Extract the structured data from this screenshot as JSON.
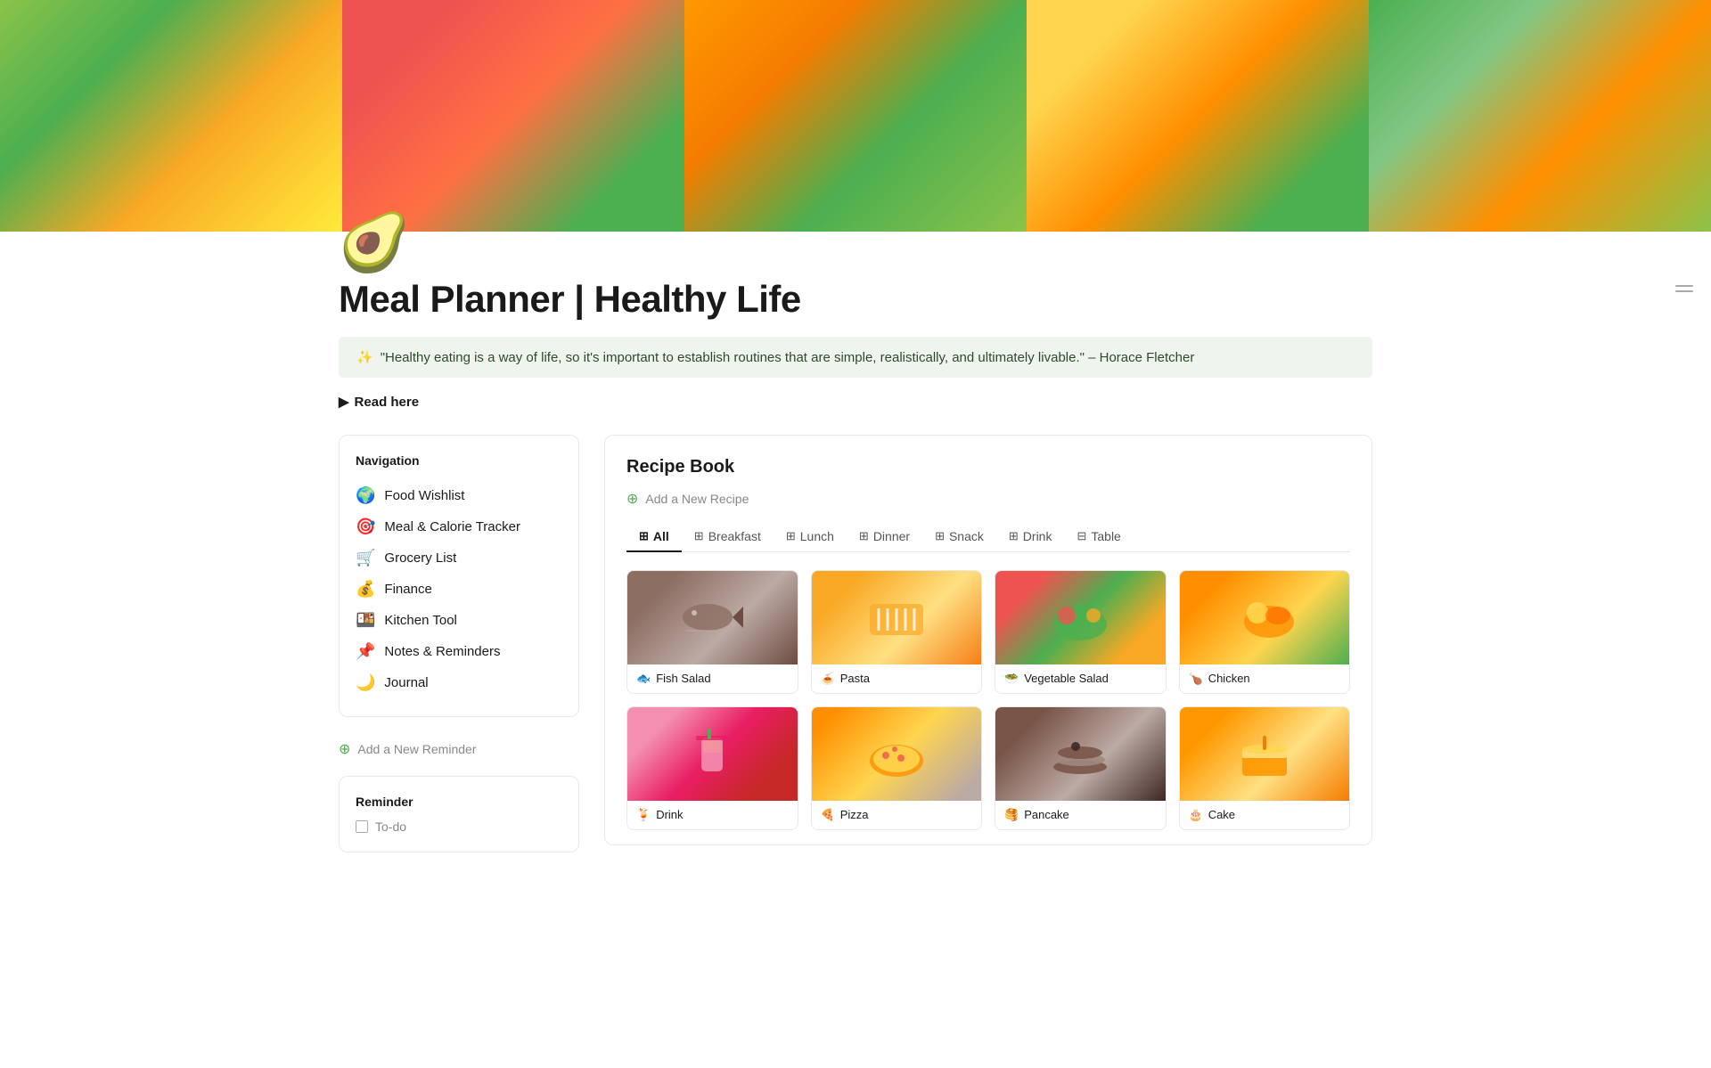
{
  "hero": {
    "images": [
      {
        "id": "hero-1",
        "class": "hero-img-1"
      },
      {
        "id": "hero-2",
        "class": "hero-img-2"
      },
      {
        "id": "hero-3",
        "class": "hero-img-3"
      },
      {
        "id": "hero-4",
        "class": "hero-img-4"
      },
      {
        "id": "hero-5",
        "class": "hero-img-5"
      }
    ]
  },
  "avocado": "🥑",
  "page_title": "Meal Planner | Healthy Life",
  "quote": {
    "icon": "✨",
    "text": "\"Healthy eating is a way of life, so it's important to establish routines that are simple, realistically, and ultimately livable.\" – Horace Fletcher"
  },
  "read_here": {
    "arrow": "▶",
    "label": "Read here"
  },
  "navigation": {
    "title": "Navigation",
    "items": [
      {
        "emoji": "🌍",
        "label": "Food Wishlist"
      },
      {
        "emoji": "🎯",
        "label": "Meal & Calorie Tracker"
      },
      {
        "emoji": "🛒",
        "label": "Grocery List"
      },
      {
        "emoji": "💰",
        "label": "Finance"
      },
      {
        "emoji": "🍱",
        "label": "Kitchen Tool"
      },
      {
        "emoji": "📌",
        "label": "Notes & Reminders"
      },
      {
        "emoji": "🌙",
        "label": "Journal"
      }
    ]
  },
  "add_reminder": {
    "icon": "⊕",
    "label": "Add a New Reminder"
  },
  "reminder": {
    "title": "Reminder",
    "todo_label": "To-do"
  },
  "recipe_book": {
    "title": "Recipe Book",
    "add_label": "Add a New Recipe",
    "add_icon": "⊕",
    "tabs": [
      {
        "label": "All",
        "icon": "⊞",
        "active": true
      },
      {
        "label": "Breakfast",
        "icon": "⊞",
        "active": false
      },
      {
        "label": "Lunch",
        "icon": "⊞",
        "active": false
      },
      {
        "label": "Dinner",
        "icon": "⊞",
        "active": false
      },
      {
        "label": "Snack",
        "icon": "⊞",
        "active": false
      },
      {
        "label": "Drink",
        "icon": "⊞",
        "active": false
      },
      {
        "label": "Table",
        "icon": "⊟",
        "active": false
      }
    ],
    "recipes": [
      {
        "emoji": "🐟",
        "label": "Fish Salad",
        "color_class": "food-fish"
      },
      {
        "emoji": "🍝",
        "label": "Pasta",
        "color_class": "food-pasta"
      },
      {
        "emoji": "🥗",
        "label": "Vegetable Salad",
        "color_class": "food-salad"
      },
      {
        "emoji": "🍗",
        "label": "Chicken",
        "color_class": "food-chicken"
      },
      {
        "emoji": "🍹",
        "label": "Drink",
        "color_class": "food-drink"
      },
      {
        "emoji": "🍕",
        "label": "Pizza",
        "color_class": "food-pizza"
      },
      {
        "emoji": "🥞",
        "label": "Pancake",
        "color_class": "food-pancake"
      },
      {
        "emoji": "🎂",
        "label": "Cake",
        "color_class": "food-cake"
      }
    ]
  }
}
